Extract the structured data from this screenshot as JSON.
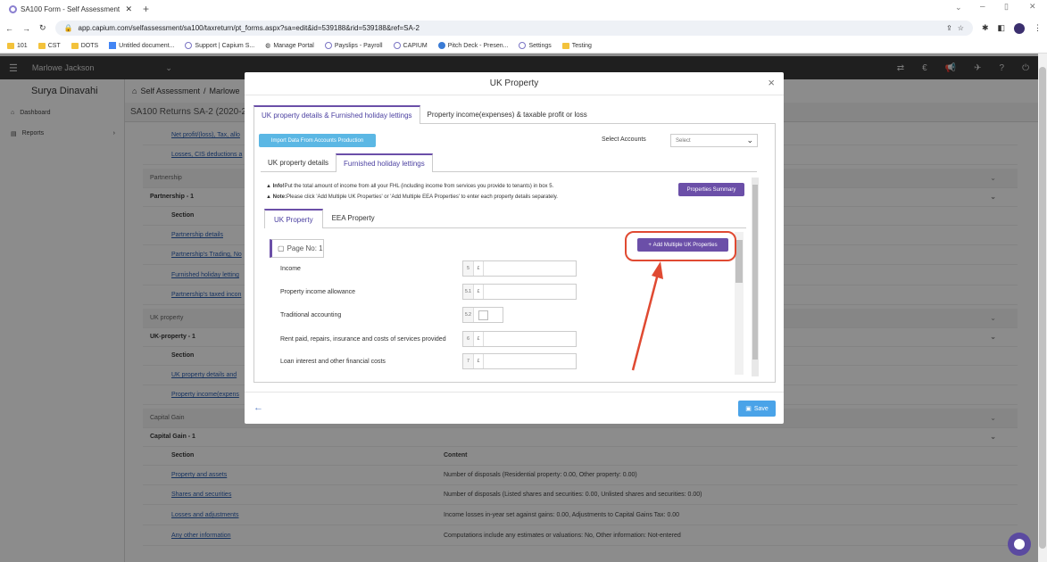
{
  "browser": {
    "tab_title": "SA100 Form - Self Assessment",
    "url": "app.capium.com/selfassessment/sa100/taxreturn/pt_forms.aspx?sa=edit&id=539188&rid=539188&ref=SA-2",
    "bookmarks": [
      "101",
      "CST",
      "DOTS",
      "Untitled document...",
      "Support | Capium S...",
      "Manage Portal",
      "Payslips - Payroll",
      "CAPIUM",
      "Pitch Deck - Presen...",
      "Settings",
      "Testing"
    ]
  },
  "app": {
    "client_name": "Marlowe Jackson",
    "user_name": "Surya Dinavahi",
    "nav": [
      "Dashboard",
      "Reports"
    ],
    "breadcrumb": [
      "Self Assessment",
      "Marlowe"
    ],
    "sub_header": "SA100 Returns SA-2 (2020-21)"
  },
  "background_rows": {
    "links_top": [
      "Net profit/(loss), Tax, allo",
      "Losses, CIS deductions a"
    ],
    "partnership_group": "Partnership",
    "partnership_item": "Partnership - 1",
    "section_label": "Section",
    "content_label": "Content",
    "partnership_links": [
      "Partnership details",
      "Partnership's Trading, No",
      "Furnished holiday letting",
      "Partnership's taxed incon"
    ],
    "uk_group": "UK property",
    "uk_item": "UK-property - 1",
    "uk_links": [
      "UK property details and",
      "Property income(expens"
    ],
    "cg_group": "Capital Gain",
    "cg_item": "Capital Gain - 1",
    "cg_rows": [
      {
        "link": "Property and assets",
        "content": "Number of disposals (Residential property: 0.00, Other property: 0.00)"
      },
      {
        "link": "Shares and securities",
        "content": "Number of disposals (Listed shares and securities: 0.00, Unlisted shares and securities: 0.00)"
      },
      {
        "link": "Losses and adjustments",
        "content": "Income losses in-year set against gains: 0.00, Adjustments to Capital Gains Tax: 0.00"
      },
      {
        "link": "Any other information",
        "content": "Computations include any estimates or valuations: No, Other information: Not-entered"
      }
    ]
  },
  "modal": {
    "title": "UK Property",
    "outer_tabs": [
      "UK property details & Furnished holiday lettings",
      "Property income(expenses) & taxable profit or loss"
    ],
    "import_btn": "Import Data From Accounts Production",
    "select_accounts_label": "Select Accounts",
    "select_accounts_value": "Select",
    "inner_tabs": [
      "UK property details",
      "Furnished holiday lettings"
    ],
    "info_bold": "Info!",
    "info_text": "Put the total amount of income from all your FHL (including income from services you provide to tenants) in box 5.",
    "note_bold": "Note:",
    "note_text": "Please click 'Add Multiple UK Properties' or 'Add Multiple EEA Properties' to enter each property details separately.",
    "properties_summary_btn": "Properties Summary",
    "property_tabs": [
      "UK Property",
      "EEA Property"
    ],
    "page_no": "Page No: 1",
    "add_multi_btn": "Add Multiple UK Properties",
    "fields": [
      {
        "label": "Income",
        "code": "5",
        "currency": "£",
        "value": ""
      },
      {
        "label": "Property income allowance",
        "code": "5.1",
        "currency": "£",
        "value": ""
      },
      {
        "label": "Traditional accounting",
        "code": "5.2",
        "currency": "",
        "value": ""
      },
      {
        "label": "Rent paid, repairs, insurance and costs of services provided",
        "code": "6",
        "currency": "£",
        "value": ""
      },
      {
        "label": "Loan interest and other financial costs",
        "code": "7",
        "currency": "£",
        "value": ""
      }
    ],
    "save_btn": "Save"
  },
  "colors": {
    "accent": "#6b4fa8",
    "highlight": "#e04a32",
    "info_btn": "#5bb7e4",
    "save_btn": "#4aa3e8"
  }
}
